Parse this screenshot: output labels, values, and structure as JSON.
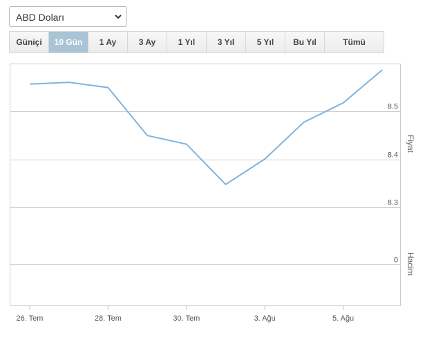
{
  "currency": {
    "selected": "ABD Doları"
  },
  "tabs": [
    {
      "label": "Güniçi",
      "active": false
    },
    {
      "label": "10 Gün",
      "active": true
    },
    {
      "label": "1 Ay",
      "active": false
    },
    {
      "label": "3 Ay",
      "active": false
    },
    {
      "label": "1 Yıl",
      "active": false
    },
    {
      "label": "3 Yıl",
      "active": false
    },
    {
      "label": "5 Yıl",
      "active": false
    },
    {
      "label": "Bu Yıl",
      "active": false
    },
    {
      "label": "Tümü",
      "active": false
    }
  ],
  "colors": {
    "line": "#7fb3de",
    "grid": "#cccccc",
    "active_tab": "#a9c4d6"
  },
  "chart_data": {
    "type": "line",
    "price_axis_label": "Fiyat",
    "volume_axis_label": "Hacim",
    "y_ticks": [
      8.5,
      8.4,
      8.3
    ],
    "y_tick_labels": [
      "8.5",
      "8.4",
      "8.3"
    ],
    "ylim": [
      8.27,
      8.6
    ],
    "volume_ticks": [
      0
    ],
    "volume_tick_labels": [
      "0"
    ],
    "x_tick_labels": [
      "26. Tem",
      "28. Tem",
      "30. Tem",
      "3. Ağu",
      "5. Ağu"
    ],
    "x_tick_day_index": [
      0,
      2,
      4,
      6,
      8
    ],
    "series": [
      {
        "x": [
          0,
          1,
          2,
          3,
          4,
          5,
          6,
          7,
          8,
          9
        ],
        "values": [
          8.557,
          8.561,
          8.55,
          8.45,
          8.432,
          8.348,
          8.401,
          8.478,
          8.518,
          8.587
        ]
      }
    ]
  }
}
